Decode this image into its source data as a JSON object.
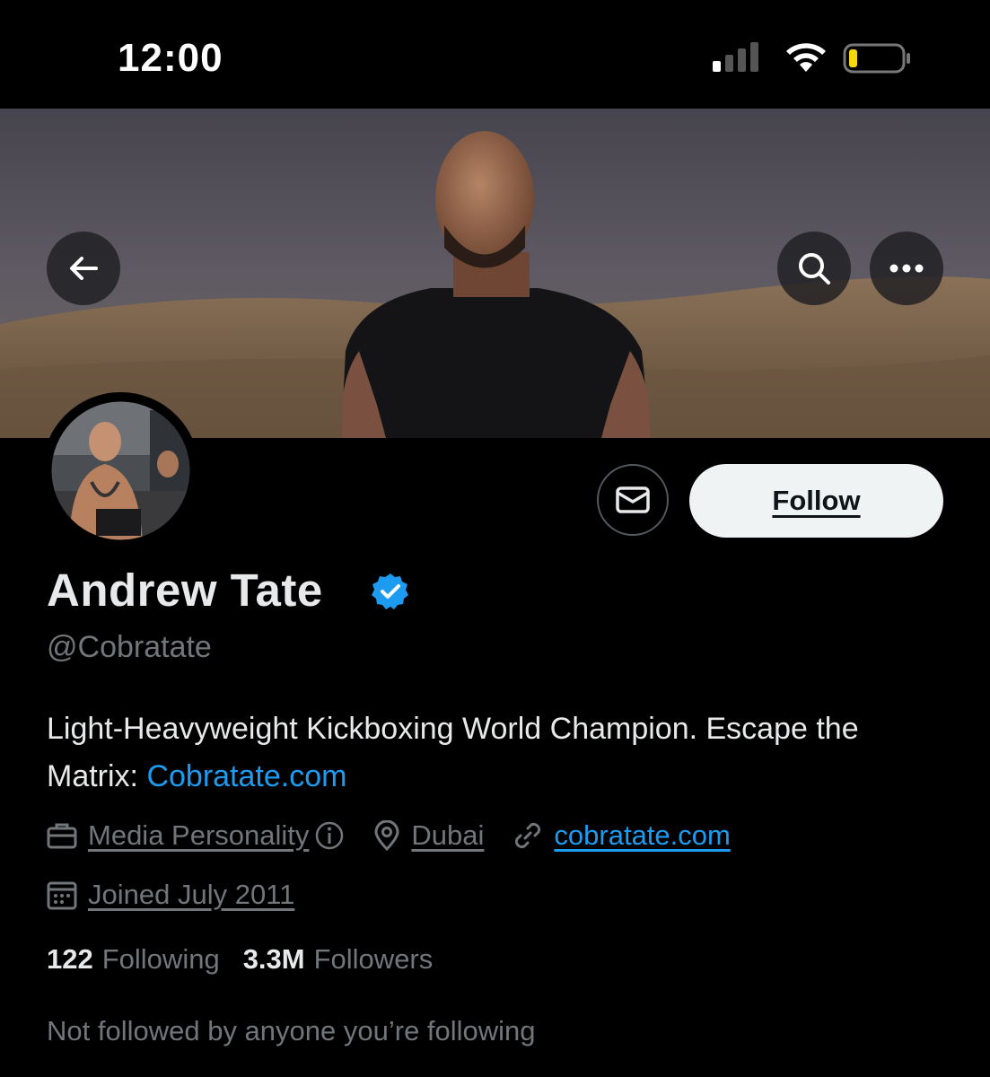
{
  "status_bar": {
    "time": "12:00"
  },
  "profile": {
    "display_name": "Andrew Tate",
    "handle": "@Cobratate",
    "bio_text": "Light-Heavyweight Kickboxing World Champion. Escape the Matrix: ",
    "bio_link": "Cobratate.com",
    "category": "Media Personality",
    "location": "Dubai",
    "website": "cobratate.com",
    "joined": "Joined July 2011",
    "following_count": "122",
    "following_label": "Following",
    "followers_count": "3.3M",
    "followers_label": "Followers",
    "followed_by": "Not followed by anyone you’re following"
  },
  "actions": {
    "follow_label": "Follow"
  },
  "colors": {
    "background": "#000000",
    "accent": "#1d9bf0",
    "secondary_text": "#71767b",
    "primary_text": "#e7e9ea",
    "follow_bg": "#eff3f4"
  },
  "icons": [
    "back-arrow-icon",
    "search-icon",
    "more-icon",
    "message-icon",
    "verified-badge-icon",
    "briefcase-icon",
    "info-icon",
    "location-pin-icon",
    "link-icon",
    "calendar-icon"
  ]
}
